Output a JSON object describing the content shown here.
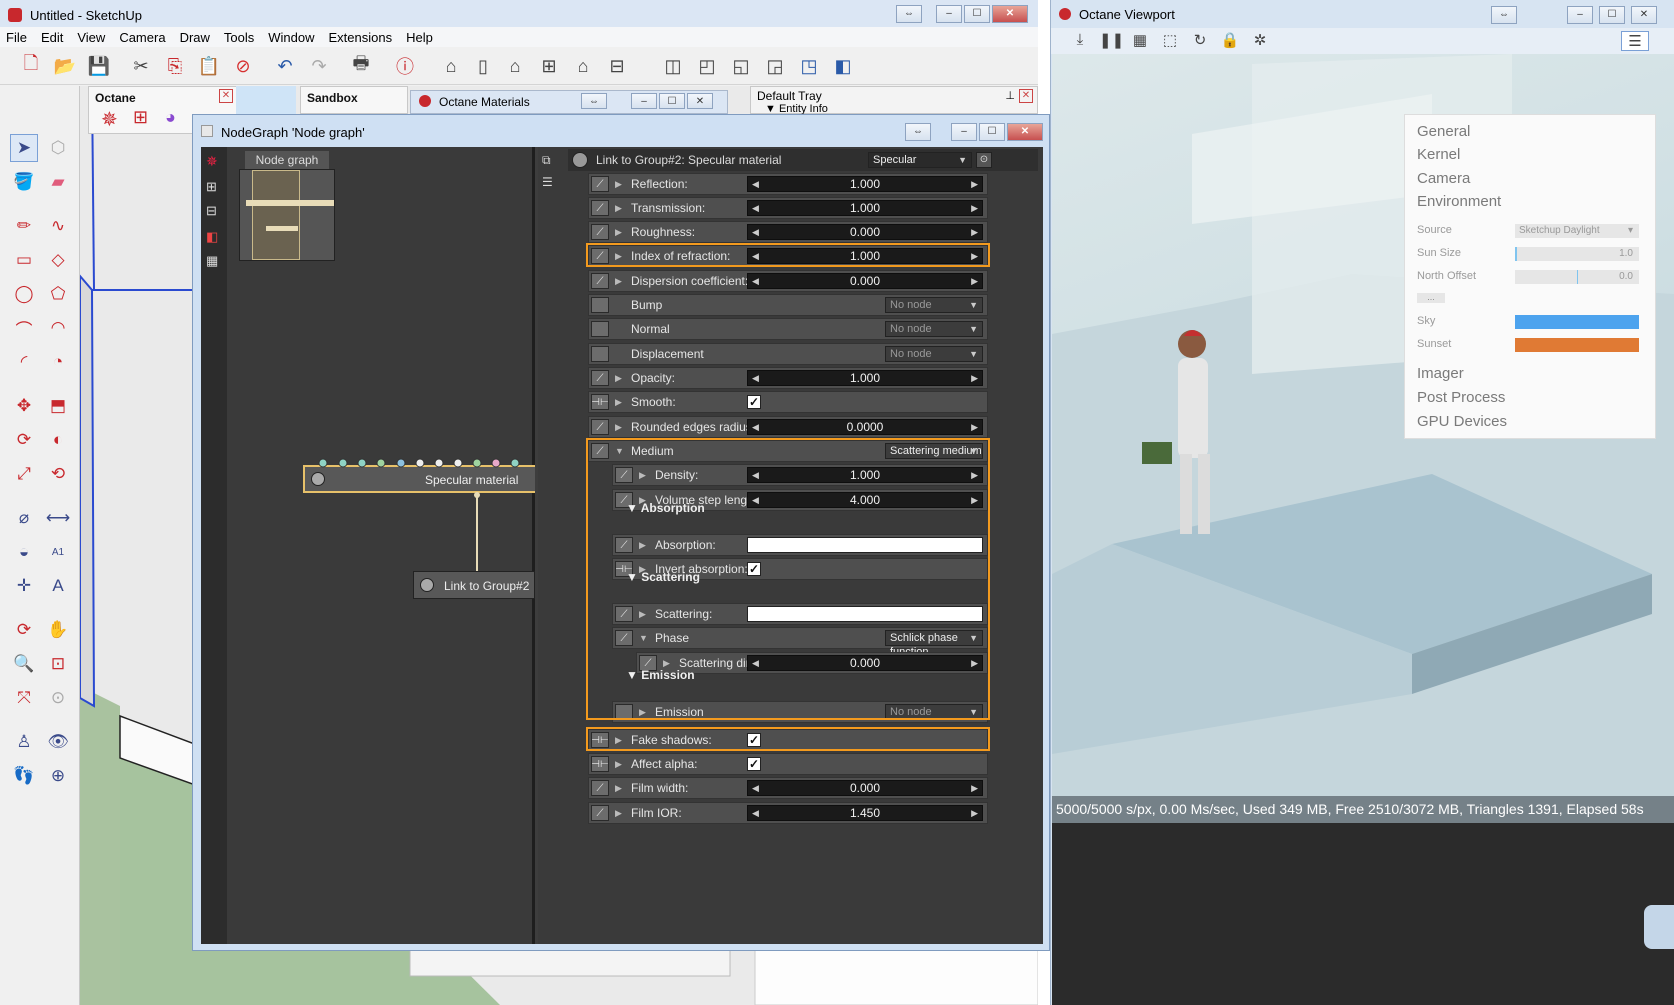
{
  "sketchup": {
    "title": "Untitled - SketchUp",
    "menu": [
      "File",
      "Edit",
      "View",
      "Camera",
      "Draw",
      "Tools",
      "Window",
      "Extensions",
      "Help"
    ],
    "panels": {
      "octane": "Octane",
      "sandbox": "Sandbox",
      "octane_materials": "Octane Materials",
      "default_tray": "Default Tray",
      "entity_info": "Entity Info"
    }
  },
  "nodegraph": {
    "title": "NodeGraph 'Node graph'",
    "tab": "Node graph",
    "nodes": {
      "specular": "Specular material",
      "link": "Link to Group#2"
    },
    "inspector": {
      "header": "Link to Group#2: Specular material",
      "type": "Specular",
      "rows": {
        "reflection": {
          "label": "Reflection:",
          "value": "1.000"
        },
        "transmission": {
          "label": "Transmission:",
          "value": "1.000"
        },
        "roughness": {
          "label": "Roughness:",
          "value": "0.000"
        },
        "ior": {
          "label": "Index of refraction:",
          "value": "1.000"
        },
        "dispersion": {
          "label": "Dispersion coefficient:",
          "value": "0.000"
        },
        "bump": {
          "label": "Bump",
          "value": "No node"
        },
        "normal": {
          "label": "Normal",
          "value": "No node"
        },
        "displacement": {
          "label": "Displacement",
          "value": "No node"
        },
        "opacity": {
          "label": "Opacity:",
          "value": "1.000"
        },
        "smooth": {
          "label": "Smooth:"
        },
        "rounded": {
          "label": "Rounded edges radius:",
          "value": "0.0000"
        },
        "medium": {
          "label": "Medium",
          "value": "Scattering medium"
        },
        "density": {
          "label": "Density:",
          "value": "1.000"
        },
        "volume_step": {
          "label": "Volume step length:",
          "value": "4.000"
        },
        "absorption_section": "Absorption",
        "absorption": {
          "label": "Absorption:"
        },
        "invert_absorption": {
          "label": "Invert absorption:"
        },
        "scattering_section": "Scattering",
        "scattering": {
          "label": "Scattering:"
        },
        "phase": {
          "label": "Phase",
          "value": "Schlick phase function"
        },
        "scattering_direction": {
          "label": "Scattering direction:",
          "value": "0.000"
        },
        "emission_section": "Emission",
        "emission": {
          "label": "Emission",
          "value": "No node"
        },
        "fake_shadows": {
          "label": "Fake shadows:"
        },
        "affect_alpha": {
          "label": "Affect alpha:"
        },
        "film_width": {
          "label": "Film width:",
          "value": "0.000"
        },
        "film_ior": {
          "label": "Film IOR:",
          "value": "1.450"
        }
      }
    }
  },
  "viewport": {
    "title": "Octane Viewport",
    "status": "5000/5000 s/px, 0.00 Ms/sec, Used 349 MB, Free 2510/3072 MB, Triangles 1391, Elapsed 58s",
    "menu": {
      "general": "General",
      "kernel": "Kernel",
      "camera": "Camera",
      "environment": "Environment",
      "source_label": "Source",
      "source_value": "Sketchup Daylight",
      "sun_size_label": "Sun Size",
      "sun_size_value": "1.0",
      "north_offset_label": "North Offset",
      "north_offset_value": "0.0",
      "more": "...",
      "sky_label": "Sky",
      "sky_color": "#4da3ee",
      "sunset_label": "Sunset",
      "sunset_color": "#e07a34",
      "imager": "Imager",
      "post_process": "Post Process",
      "gpu_devices": "GPU Devices"
    }
  },
  "colors": {
    "highlight": "#f39a1e",
    "sky": "#4da3ee",
    "sunset": "#e07a34"
  }
}
